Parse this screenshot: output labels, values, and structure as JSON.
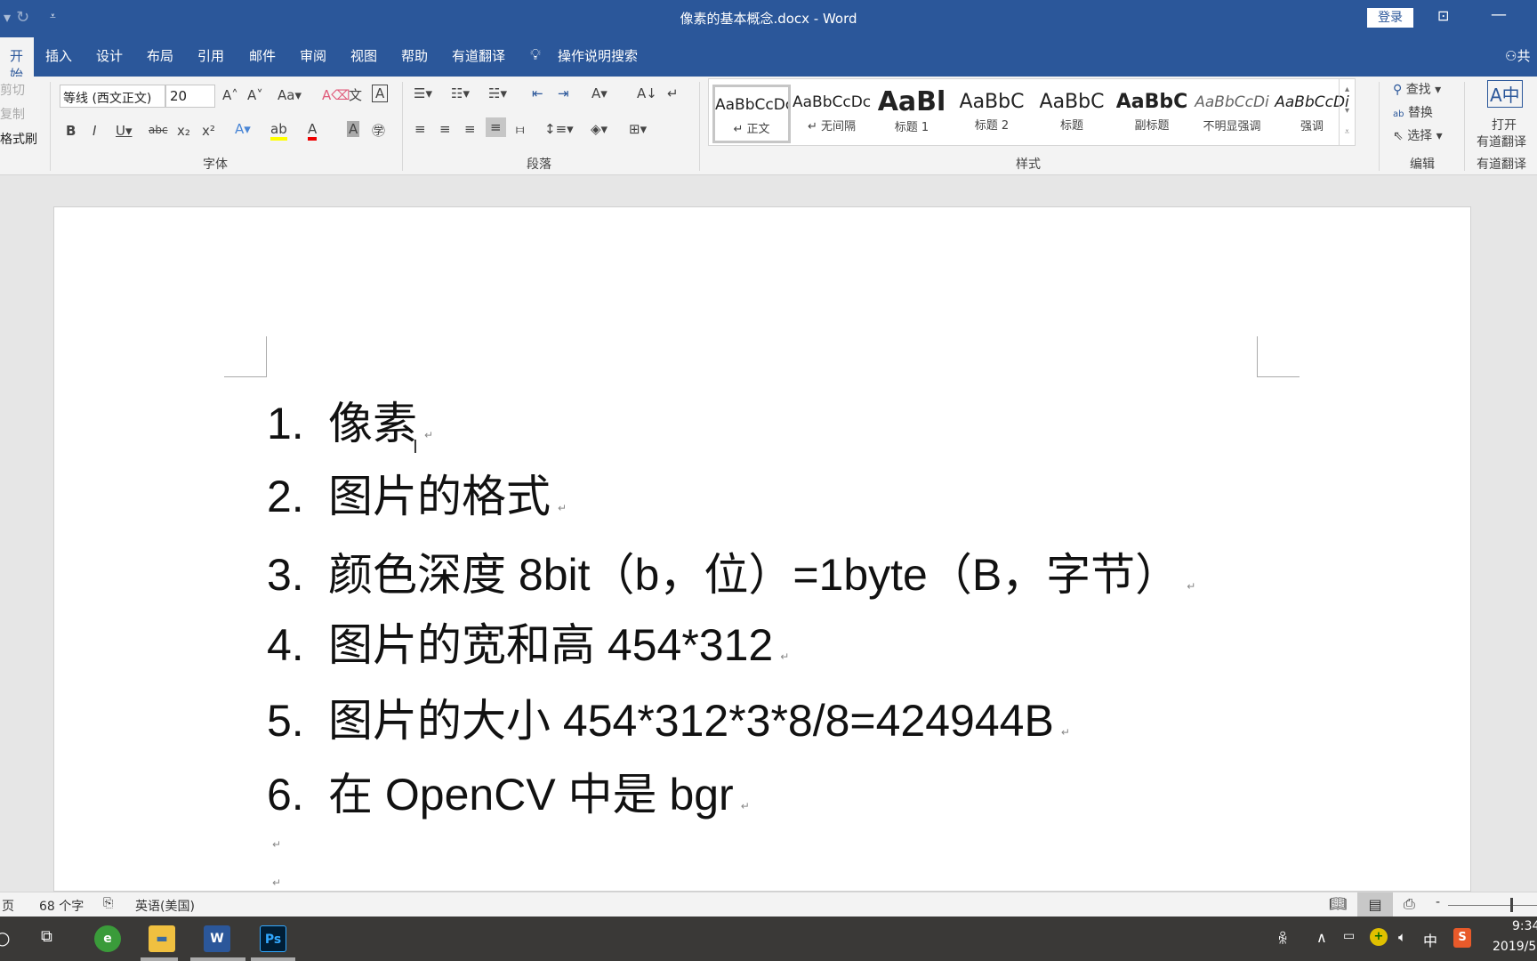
{
  "titlebar": {
    "title": "像素的基本概念.docx  -  Word",
    "login": "登录",
    "undo_icon": "undo-icon",
    "qat_icon": "customize-icon"
  },
  "tabs": [
    {
      "label": "开始",
      "active": true
    },
    {
      "label": "插入"
    },
    {
      "label": "设计"
    },
    {
      "label": "布局"
    },
    {
      "label": "引用"
    },
    {
      "label": "邮件"
    },
    {
      "label": "审阅"
    },
    {
      "label": "视图"
    },
    {
      "label": "帮助"
    },
    {
      "label": "有道翻译"
    }
  ],
  "tell_me": "操作说明搜索",
  "share": "共",
  "clipboard": {
    "cut": "剪切",
    "copy": "复制",
    "format_painter": "格式刷"
  },
  "font": {
    "name": "等线 (西文正文)",
    "size": "20",
    "group": "字体"
  },
  "paragraph": {
    "group": "段落"
  },
  "styles": {
    "group": "样式",
    "items": [
      {
        "preview": "AaBbCcDc",
        "name": "↵ 正文"
      },
      {
        "preview": "AaBbCcDc",
        "name": "↵ 无间隔"
      },
      {
        "preview": "AaBl",
        "name": "标题 1"
      },
      {
        "preview": "AaBbC",
        "name": "标题 2"
      },
      {
        "preview": "AaBbC",
        "name": "标题"
      },
      {
        "preview": "AaBbC",
        "name": "副标题"
      },
      {
        "preview": "AaBbCcDi",
        "name": "不明显强调"
      },
      {
        "preview": "AaBbCcDi",
        "name": "强调"
      }
    ]
  },
  "editing": {
    "find": "查找",
    "replace": "替换",
    "select": "选择",
    "group": "编辑"
  },
  "youdao": {
    "open": "打开",
    "open2": "有道翻译",
    "group": "有道翻译"
  },
  "document": {
    "lines": [
      {
        "num": "1.",
        "text": "像素"
      },
      {
        "num": "2.",
        "text": "图片的格式"
      },
      {
        "num": "3.",
        "text": "颜色深度  8bit（b，位）=1byte（B，字节）"
      },
      {
        "num": "4.",
        "text": "图片的宽和高 454*312"
      },
      {
        "num": "5.",
        "text": "图片的大小  454*312*3*8/8=424944B"
      },
      {
        "num": "6.",
        "text": "在 OpenCV 中是 bgr"
      }
    ],
    "paragraph_mark": "↵"
  },
  "status": {
    "page": "页",
    "words": "68 个字",
    "language": "英语(美国)"
  },
  "taskbar": {
    "time": "9:34",
    "date": "2019/5",
    "ime": "中",
    "apps": [
      "edge",
      "explorer",
      "word",
      "photoshop"
    ]
  },
  "colors": {
    "accent": "#2b579a",
    "taskbar": "#3a3937"
  }
}
